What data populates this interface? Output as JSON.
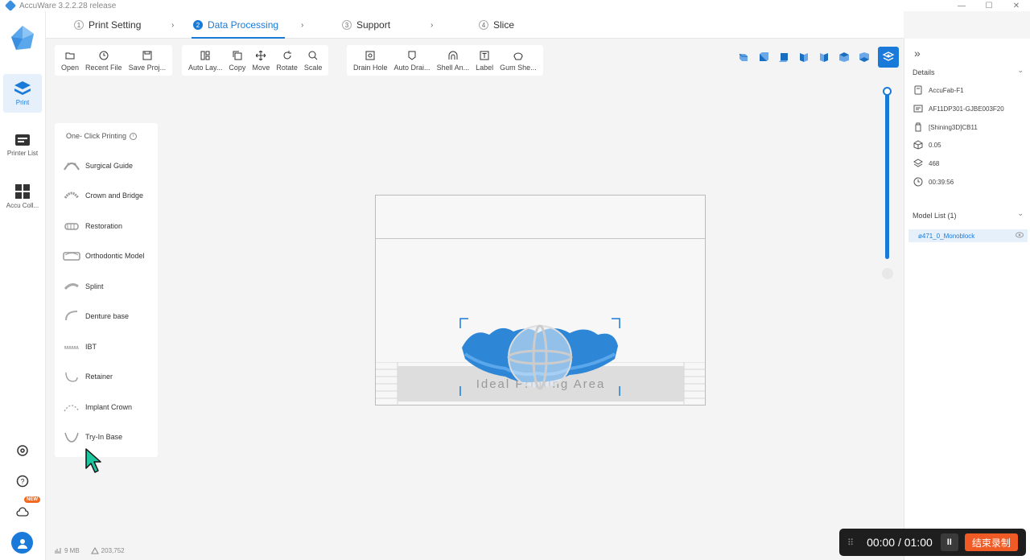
{
  "window": {
    "title": "AccuWare 3.2.2.28 release",
    "min": "—",
    "max": "☐",
    "close": "✕"
  },
  "rail": {
    "items": [
      {
        "label": "Print",
        "icon": "print-icon"
      },
      {
        "label": "Printer List",
        "icon": "printer-list-icon"
      },
      {
        "label": "Accu Coll...",
        "icon": "accu-collection-icon"
      }
    ],
    "bottom_icons": [
      "settings-icon",
      "help-icon",
      "cloud-icon"
    ],
    "new_badge": "NEW"
  },
  "steps": [
    {
      "num": "1",
      "label": "Print Setting"
    },
    {
      "num": "2",
      "label": "Data Processing"
    },
    {
      "num": "3",
      "label": "Support"
    },
    {
      "num": "4",
      "label": "Slice"
    }
  ],
  "step_arrow": "›",
  "toolbar": {
    "file": [
      {
        "label": "Open",
        "icon": "folder-icon"
      },
      {
        "label": "Recent File",
        "icon": "clock-icon"
      },
      {
        "label": "Save Proj...",
        "icon": "save-icon"
      }
    ],
    "edit": [
      {
        "label": "Auto Lay...",
        "icon": "auto-layout-icon"
      },
      {
        "label": "Copy",
        "icon": "copy-icon"
      },
      {
        "label": "Move",
        "icon": "move-icon"
      },
      {
        "label": "Rotate",
        "icon": "rotate-icon"
      },
      {
        "label": "Scale",
        "icon": "scale-icon"
      }
    ],
    "tools": [
      {
        "label": "Drain Hole",
        "icon": "drain-hole-icon"
      },
      {
        "label": "Auto Drai...",
        "icon": "auto-drain-icon"
      },
      {
        "label": "Shell An...",
        "icon": "shell-icon"
      },
      {
        "label": "Label",
        "icon": "label-icon"
      },
      {
        "label": "Gum She...",
        "icon": "gum-shell-icon"
      }
    ]
  },
  "oneclick": {
    "title": "One- Click Printing",
    "info": "i",
    "items": [
      "Surgical Guide",
      "Crown and Bridge",
      "Restoration",
      "Orthodontic Model",
      "Splint",
      "Denture base",
      "IBT",
      "Retainer",
      "Implant Crown",
      "Try-In Base"
    ]
  },
  "plate": {
    "text": "Ideal Printing Area"
  },
  "right_panel": {
    "collapse": "»",
    "details_title": "Details",
    "details": [
      {
        "icon": "printer-icon",
        "text": "AccuFab-F1"
      },
      {
        "icon": "serial-icon",
        "text": "AF11DP301-GJBE003F20"
      },
      {
        "icon": "resin-icon",
        "text": "[Shining3D]CB11"
      },
      {
        "icon": "layer-thickness-icon",
        "text": "0.05"
      },
      {
        "icon": "layers-icon",
        "text": "468"
      },
      {
        "icon": "time-icon",
        "text": "00:39:56"
      }
    ],
    "model_list_title": "Model List (1)",
    "model": "ø471_0_Monoblock",
    "chevron": "⌄"
  },
  "status": {
    "memory": "9 MB",
    "triangles": "203,752"
  },
  "recorder": {
    "time": "00:00 / 01:00",
    "pause": "II",
    "stop": "结束录制",
    "grip": "⠿"
  }
}
